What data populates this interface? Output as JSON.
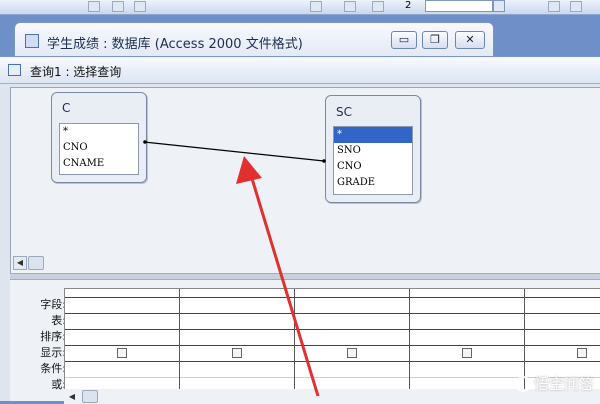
{
  "toolbar": {
    "font_size_value": "2",
    "combo_value": ""
  },
  "database_window": {
    "title": "学生成绩 : 数据库 (Access 2000 文件格式)",
    "minimize_glyph": "▭",
    "restore_glyph": "❐",
    "close_glyph": "✕"
  },
  "query_window": {
    "title": "查询1 : 选择查询"
  },
  "tables": [
    {
      "name": "C",
      "fields": [
        "*",
        "CNO",
        "CNAME"
      ],
      "selected_index": -1
    },
    {
      "name": "SC",
      "fields": [
        "*",
        "SNO",
        "CNO",
        "GRADE"
      ],
      "selected_index": 0
    }
  ],
  "qbe": {
    "row_labels": [
      "字段:",
      "表:",
      "排序:",
      "显示:",
      "条件:",
      "或:"
    ],
    "show_checkboxes": [
      false,
      false,
      false,
      false,
      false
    ]
  },
  "watermark": {
    "text": "悟空问答"
  },
  "colors": {
    "arrow": "#e03030",
    "selection": "#3166c7",
    "desktop": "#6f8fc8"
  }
}
